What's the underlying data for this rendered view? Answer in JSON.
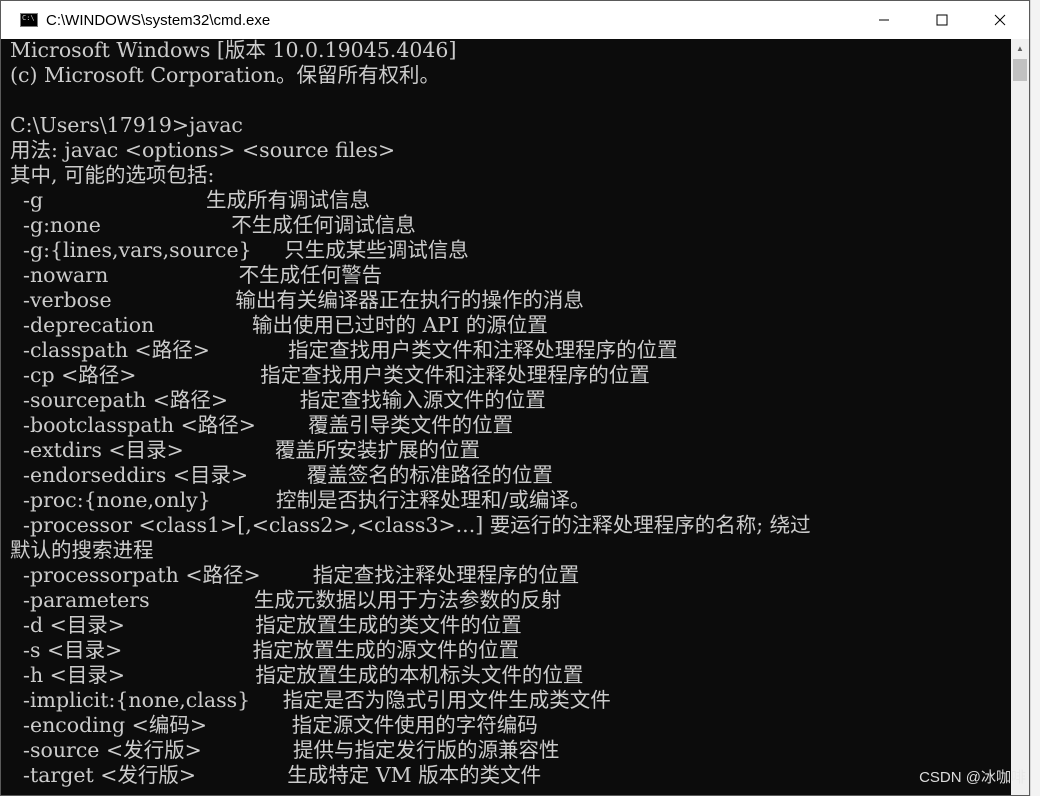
{
  "window": {
    "title": "C:\\WINDOWS\\system32\\cmd.exe"
  },
  "console": {
    "lines": [
      "Microsoft Windows [版本 10.0.19045.4046]",
      "(c) Microsoft Corporation。保留所有权利。",
      "",
      "C:\\Users\\17919>javac",
      "用法: javac <options> <source files>",
      "其中, 可能的选项包括:",
      "  -g                         生成所有调试信息",
      "  -g:none                    不生成任何调试信息",
      "  -g:{lines,vars,source}     只生成某些调试信息",
      "  -nowarn                    不生成任何警告",
      "  -verbose                   输出有关编译器正在执行的操作的消息",
      "  -deprecation               输出使用已过时的 API 的源位置",
      "  -classpath <路径>            指定查找用户类文件和注释处理程序的位置",
      "  -cp <路径>                   指定查找用户类文件和注释处理程序的位置",
      "  -sourcepath <路径>           指定查找输入源文件的位置",
      "  -bootclasspath <路径>        覆盖引导类文件的位置",
      "  -extdirs <目录>              覆盖所安装扩展的位置",
      "  -endorseddirs <目录>         覆盖签名的标准路径的位置",
      "  -proc:{none,only}          控制是否执行注释处理和/或编译。",
      "  -processor <class1>[,<class2>,<class3>...] 要运行的注释处理程序的名称; 绕过",
      "默认的搜索进程",
      "  -processorpath <路径>        指定查找注释处理程序的位置",
      "  -parameters                生成元数据以用于方法参数的反射",
      "  -d <目录>                    指定放置生成的类文件的位置",
      "  -s <目录>                    指定放置生成的源文件的位置",
      "  -h <目录>                    指定放置生成的本机标头文件的位置",
      "  -implicit:{none,class}     指定是否为隐式引用文件生成类文件",
      "  -encoding <编码>             指定源文件使用的字符编码",
      "  -source <发行版>              提供与指定发行版的源兼容性",
      "  -target <发行版>              生成特定 VM 版本的类文件"
    ]
  },
  "watermark": "CSDN @冰咖啡",
  "icons": {
    "app": "cmd-icon",
    "minimize": "minimize-icon",
    "maximize": "maximize-icon",
    "close": "close-icon"
  }
}
